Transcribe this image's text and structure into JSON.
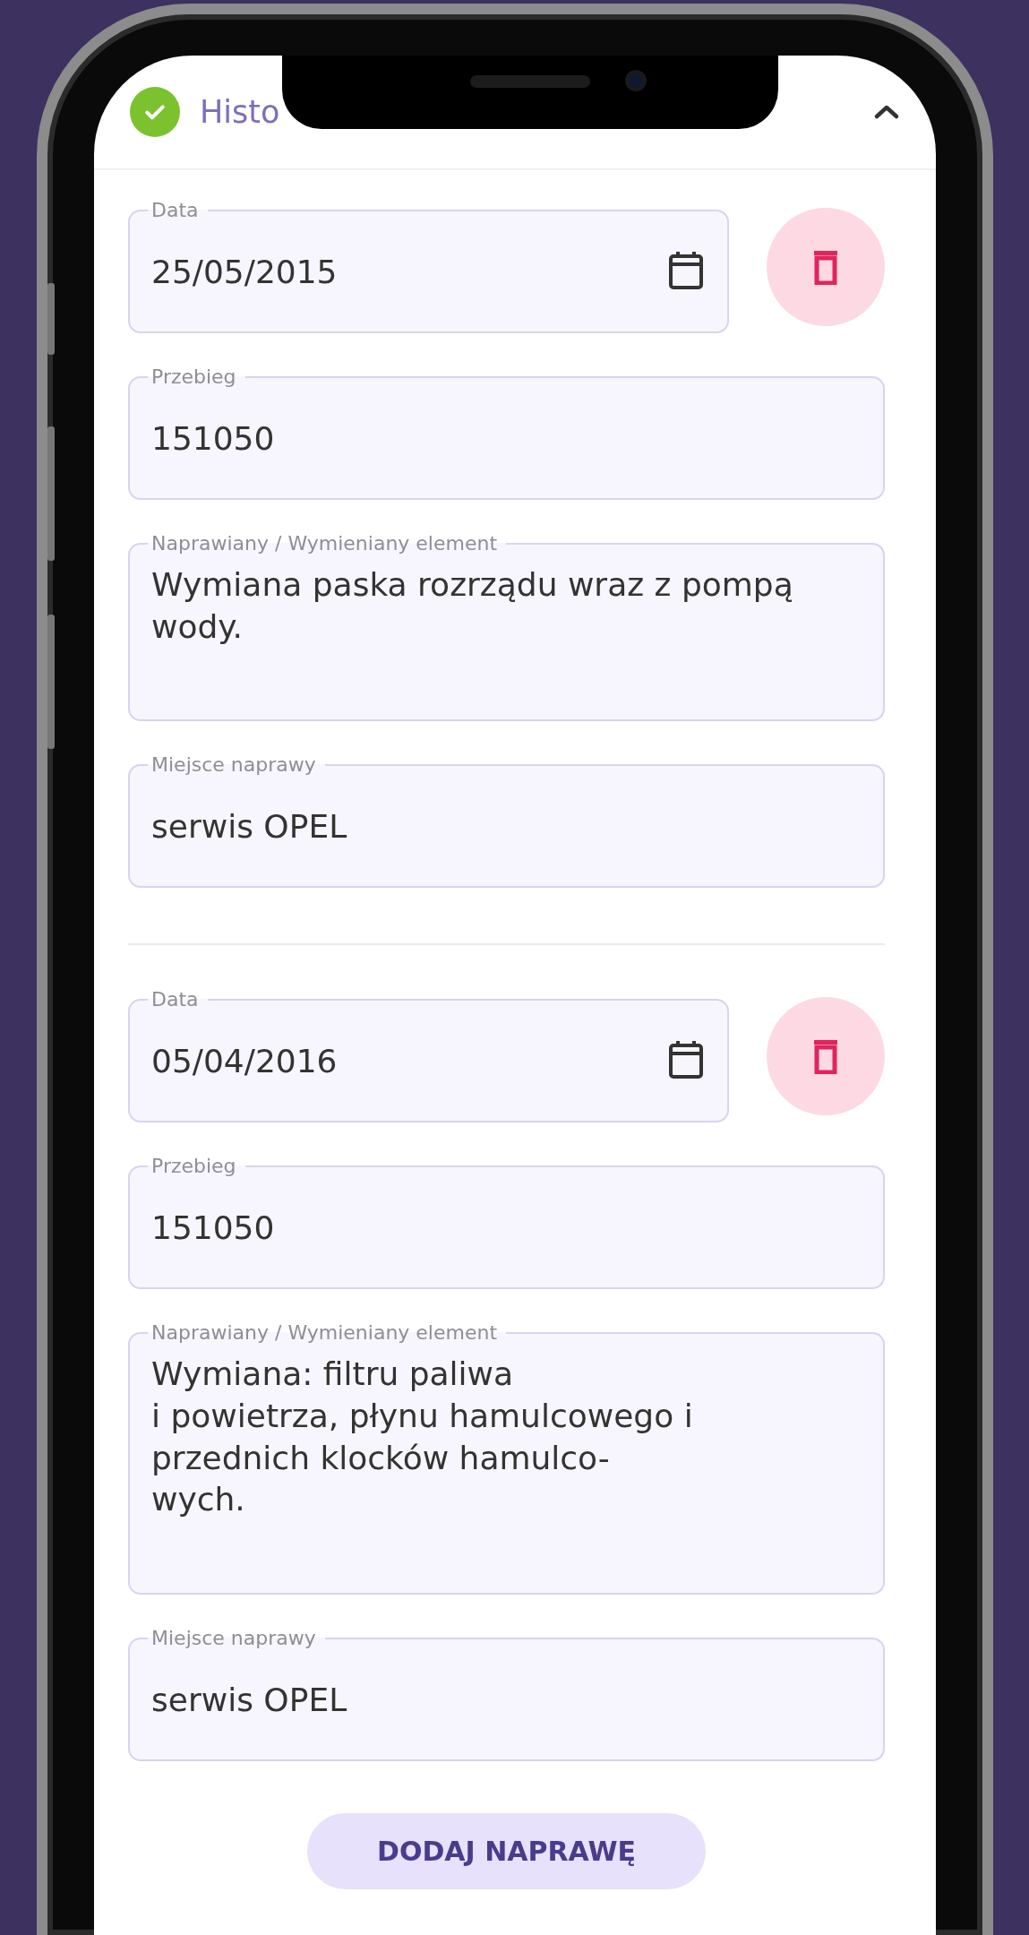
{
  "header": {
    "title": "Histo",
    "completed": true,
    "expanded": true
  },
  "repairs": [
    {
      "date_label": "Data",
      "date": "25/05/2015",
      "mileage_label": "Przebieg",
      "mileage": "151050",
      "element_label": "Naprawiany / Wymieniany element",
      "element": "Wymiana paska rozrządu wraz z pompą\nwody.",
      "place_label": "Miejsce naprawy",
      "place": "serwis OPEL"
    },
    {
      "date_label": "Data",
      "date": "05/04/2016",
      "mileage_label": "Przebieg",
      "mileage": "151050",
      "element_label": "Naprawiany / Wymieniany element",
      "element": "Wymiana: filtru paliwa\ni powietrza, płynu hamulcowego i\nprzednich klocków hamulco-\nwych.",
      "place_label": "Miejsce naprawy",
      "place": "serwis OPEL"
    }
  ],
  "add_button": "DODAJ NAPRAWĘ"
}
